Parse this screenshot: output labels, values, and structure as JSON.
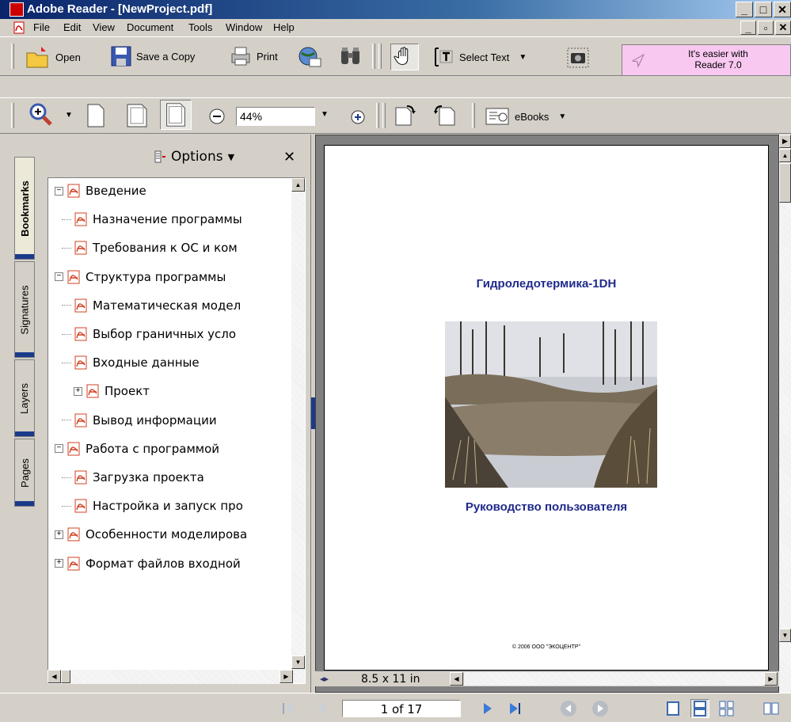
{
  "window": {
    "title": "Adobe Reader - [NewProject.pdf]"
  },
  "menu": [
    "File",
    "Edit",
    "View",
    "Document",
    "Tools",
    "Window",
    "Help"
  ],
  "toolbar": {
    "open_label": "Open",
    "save_label": "Save a Copy",
    "print_label": "Print",
    "select_text_label": "Select Text",
    "ebooks_label": "eBooks",
    "zoom_value": "44%",
    "ad_line1": "It's easier with",
    "ad_line2": "Reader 7.0"
  },
  "nav": {
    "tabs": [
      "Bookmarks",
      "Signatures",
      "Layers",
      "Pages"
    ],
    "options_label": "Options",
    "bookmarks": [
      {
        "label": "Введение",
        "level": 0,
        "expander": "minus"
      },
      {
        "label": "Назначение программы",
        "level": 1,
        "expander": ""
      },
      {
        "label": "Требования к ОС и ком",
        "level": 1,
        "expander": ""
      },
      {
        "label": "Структура программы",
        "level": 0,
        "expander": "minus"
      },
      {
        "label": "Математическая модел",
        "level": 1,
        "expander": ""
      },
      {
        "label": "Выбор граничных усло",
        "level": 1,
        "expander": ""
      },
      {
        "label": "Входные данные",
        "level": 1,
        "expander": ""
      },
      {
        "label": "Проект",
        "level": 1,
        "expander": "plus"
      },
      {
        "label": "Вывод информации",
        "level": 1,
        "expander": ""
      },
      {
        "label": "Работа с программой",
        "level": 0,
        "expander": "minus"
      },
      {
        "label": "Загрузка проекта",
        "level": 1,
        "expander": ""
      },
      {
        "label": "Настройка и запуск про",
        "level": 1,
        "expander": ""
      },
      {
        "label": "Особенности моделирова",
        "level": 0,
        "expander": "plus"
      },
      {
        "label": "Формат файлов входной",
        "level": 0,
        "expander": "plus"
      }
    ]
  },
  "document": {
    "title": "Гидроледотермика-1DH",
    "subtitle": "Руководство пользователя",
    "copyright": "© 2006 ООО \"ЭКОЦЕНТР\"",
    "page_size": "8.5 x 11 in"
  },
  "status": {
    "page_indicator": "1 of 17"
  }
}
